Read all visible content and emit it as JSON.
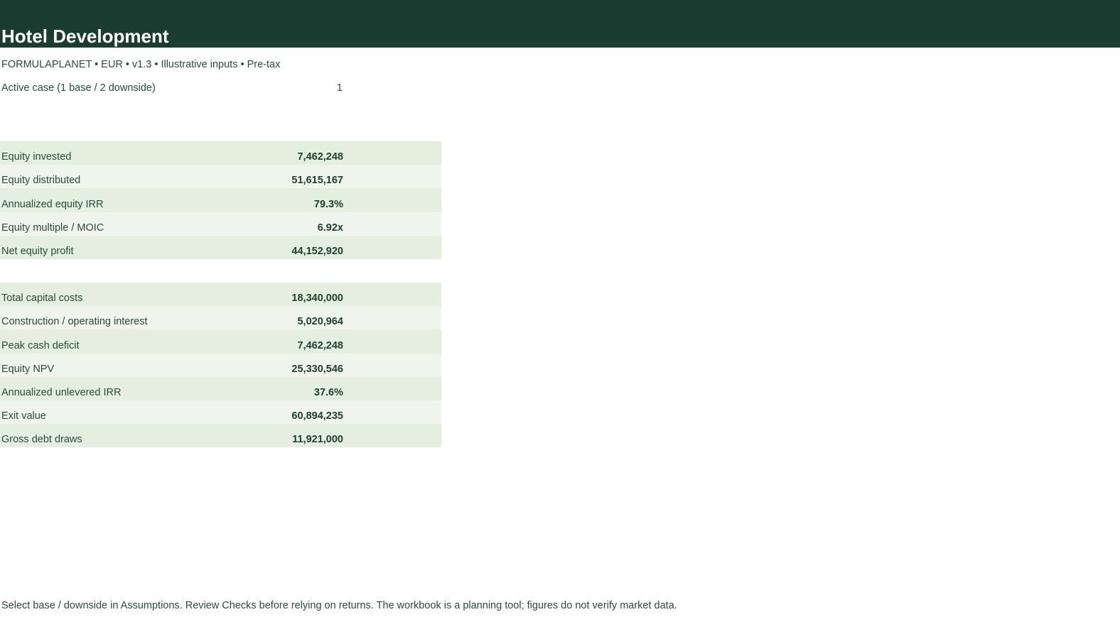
{
  "header": {
    "title": "Hotel Development",
    "subtitle": "FORMULAPLANET  •  EUR  •  v1.3  •  Illustrative inputs  •  Pre-tax",
    "colors": {
      "header_bg": "#1b3c30",
      "row_odd": "#e4efe0",
      "row_even": "#eff4ec"
    }
  },
  "case": {
    "label": "Active case (1 base / 2 downside)",
    "value": "1"
  },
  "equity_block": {
    "rows": [
      {
        "label": "Equity invested",
        "value": "7,462,248"
      },
      {
        "label": "Equity distributed",
        "value": "51,615,167"
      },
      {
        "label": "Annualized equity IRR",
        "value": "79.3%"
      },
      {
        "label": "Equity multiple / MOIC",
        "value": "6.92x"
      },
      {
        "label": "Net equity profit",
        "value": "44,152,920"
      }
    ]
  },
  "project_block": {
    "rows": [
      {
        "label": "Total capital costs",
        "value": "18,340,000"
      },
      {
        "label": "Construction / operating interest",
        "value": "5,020,964"
      },
      {
        "label": "Peak cash deficit",
        "value": "7,462,248"
      },
      {
        "label": "Equity NPV",
        "value": "25,330,546"
      },
      {
        "label": "Annualized unlevered IRR",
        "value": "37.6%"
      },
      {
        "label": "Exit value",
        "value": "60,894,235"
      },
      {
        "label": "Gross debt draws",
        "value": "11,921,000"
      }
    ]
  },
  "footer": {
    "note": "Select base / downside in Assumptions. Review Checks before relying on returns. The workbook is a planning tool; figures do not verify market data."
  }
}
